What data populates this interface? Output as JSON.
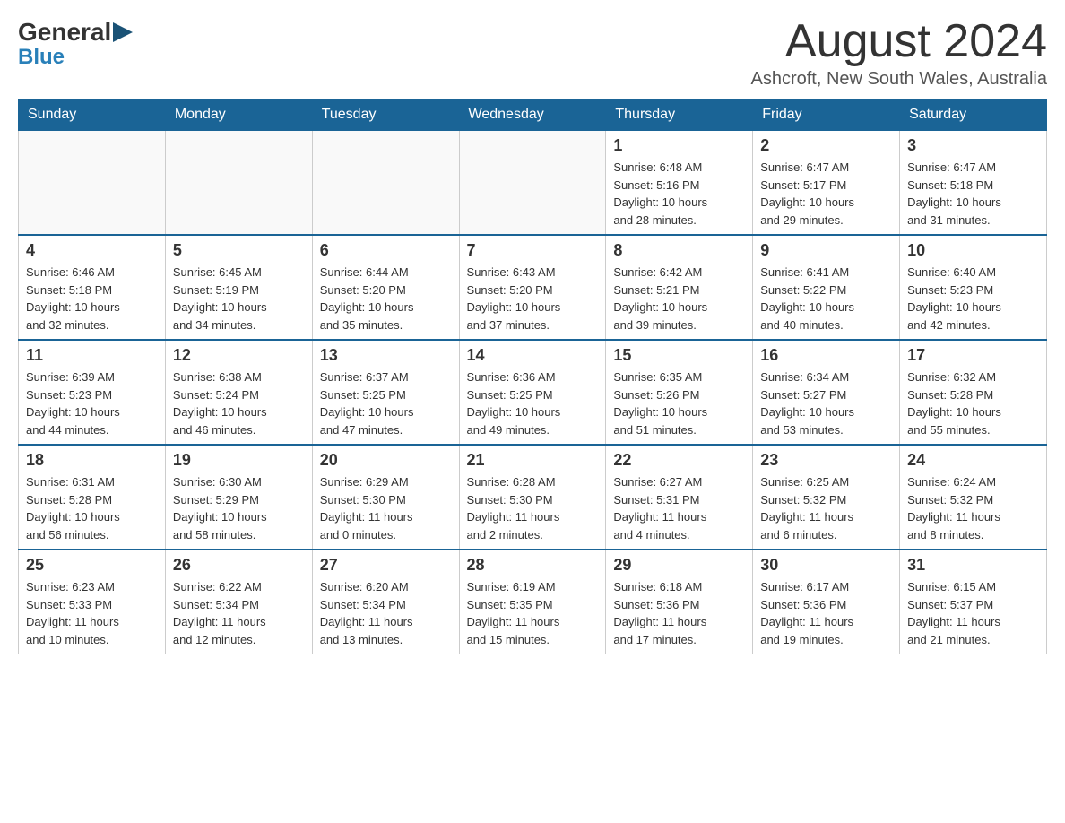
{
  "logo": {
    "general": "General",
    "blue": "Blue"
  },
  "header": {
    "month": "August 2024",
    "location": "Ashcroft, New South Wales, Australia"
  },
  "days_of_week": [
    "Sunday",
    "Monday",
    "Tuesday",
    "Wednesday",
    "Thursday",
    "Friday",
    "Saturday"
  ],
  "weeks": [
    [
      {
        "day": "",
        "info": ""
      },
      {
        "day": "",
        "info": ""
      },
      {
        "day": "",
        "info": ""
      },
      {
        "day": "",
        "info": ""
      },
      {
        "day": "1",
        "info": "Sunrise: 6:48 AM\nSunset: 5:16 PM\nDaylight: 10 hours\nand 28 minutes."
      },
      {
        "day": "2",
        "info": "Sunrise: 6:47 AM\nSunset: 5:17 PM\nDaylight: 10 hours\nand 29 minutes."
      },
      {
        "day": "3",
        "info": "Sunrise: 6:47 AM\nSunset: 5:18 PM\nDaylight: 10 hours\nand 31 minutes."
      }
    ],
    [
      {
        "day": "4",
        "info": "Sunrise: 6:46 AM\nSunset: 5:18 PM\nDaylight: 10 hours\nand 32 minutes."
      },
      {
        "day": "5",
        "info": "Sunrise: 6:45 AM\nSunset: 5:19 PM\nDaylight: 10 hours\nand 34 minutes."
      },
      {
        "day": "6",
        "info": "Sunrise: 6:44 AM\nSunset: 5:20 PM\nDaylight: 10 hours\nand 35 minutes."
      },
      {
        "day": "7",
        "info": "Sunrise: 6:43 AM\nSunset: 5:20 PM\nDaylight: 10 hours\nand 37 minutes."
      },
      {
        "day": "8",
        "info": "Sunrise: 6:42 AM\nSunset: 5:21 PM\nDaylight: 10 hours\nand 39 minutes."
      },
      {
        "day": "9",
        "info": "Sunrise: 6:41 AM\nSunset: 5:22 PM\nDaylight: 10 hours\nand 40 minutes."
      },
      {
        "day": "10",
        "info": "Sunrise: 6:40 AM\nSunset: 5:23 PM\nDaylight: 10 hours\nand 42 minutes."
      }
    ],
    [
      {
        "day": "11",
        "info": "Sunrise: 6:39 AM\nSunset: 5:23 PM\nDaylight: 10 hours\nand 44 minutes."
      },
      {
        "day": "12",
        "info": "Sunrise: 6:38 AM\nSunset: 5:24 PM\nDaylight: 10 hours\nand 46 minutes."
      },
      {
        "day": "13",
        "info": "Sunrise: 6:37 AM\nSunset: 5:25 PM\nDaylight: 10 hours\nand 47 minutes."
      },
      {
        "day": "14",
        "info": "Sunrise: 6:36 AM\nSunset: 5:25 PM\nDaylight: 10 hours\nand 49 minutes."
      },
      {
        "day": "15",
        "info": "Sunrise: 6:35 AM\nSunset: 5:26 PM\nDaylight: 10 hours\nand 51 minutes."
      },
      {
        "day": "16",
        "info": "Sunrise: 6:34 AM\nSunset: 5:27 PM\nDaylight: 10 hours\nand 53 minutes."
      },
      {
        "day": "17",
        "info": "Sunrise: 6:32 AM\nSunset: 5:28 PM\nDaylight: 10 hours\nand 55 minutes."
      }
    ],
    [
      {
        "day": "18",
        "info": "Sunrise: 6:31 AM\nSunset: 5:28 PM\nDaylight: 10 hours\nand 56 minutes."
      },
      {
        "day": "19",
        "info": "Sunrise: 6:30 AM\nSunset: 5:29 PM\nDaylight: 10 hours\nand 58 minutes."
      },
      {
        "day": "20",
        "info": "Sunrise: 6:29 AM\nSunset: 5:30 PM\nDaylight: 11 hours\nand 0 minutes."
      },
      {
        "day": "21",
        "info": "Sunrise: 6:28 AM\nSunset: 5:30 PM\nDaylight: 11 hours\nand 2 minutes."
      },
      {
        "day": "22",
        "info": "Sunrise: 6:27 AM\nSunset: 5:31 PM\nDaylight: 11 hours\nand 4 minutes."
      },
      {
        "day": "23",
        "info": "Sunrise: 6:25 AM\nSunset: 5:32 PM\nDaylight: 11 hours\nand 6 minutes."
      },
      {
        "day": "24",
        "info": "Sunrise: 6:24 AM\nSunset: 5:32 PM\nDaylight: 11 hours\nand 8 minutes."
      }
    ],
    [
      {
        "day": "25",
        "info": "Sunrise: 6:23 AM\nSunset: 5:33 PM\nDaylight: 11 hours\nand 10 minutes."
      },
      {
        "day": "26",
        "info": "Sunrise: 6:22 AM\nSunset: 5:34 PM\nDaylight: 11 hours\nand 12 minutes."
      },
      {
        "day": "27",
        "info": "Sunrise: 6:20 AM\nSunset: 5:34 PM\nDaylight: 11 hours\nand 13 minutes."
      },
      {
        "day": "28",
        "info": "Sunrise: 6:19 AM\nSunset: 5:35 PM\nDaylight: 11 hours\nand 15 minutes."
      },
      {
        "day": "29",
        "info": "Sunrise: 6:18 AM\nSunset: 5:36 PM\nDaylight: 11 hours\nand 17 minutes."
      },
      {
        "day": "30",
        "info": "Sunrise: 6:17 AM\nSunset: 5:36 PM\nDaylight: 11 hours\nand 19 minutes."
      },
      {
        "day": "31",
        "info": "Sunrise: 6:15 AM\nSunset: 5:37 PM\nDaylight: 11 hours\nand 21 minutes."
      }
    ]
  ]
}
